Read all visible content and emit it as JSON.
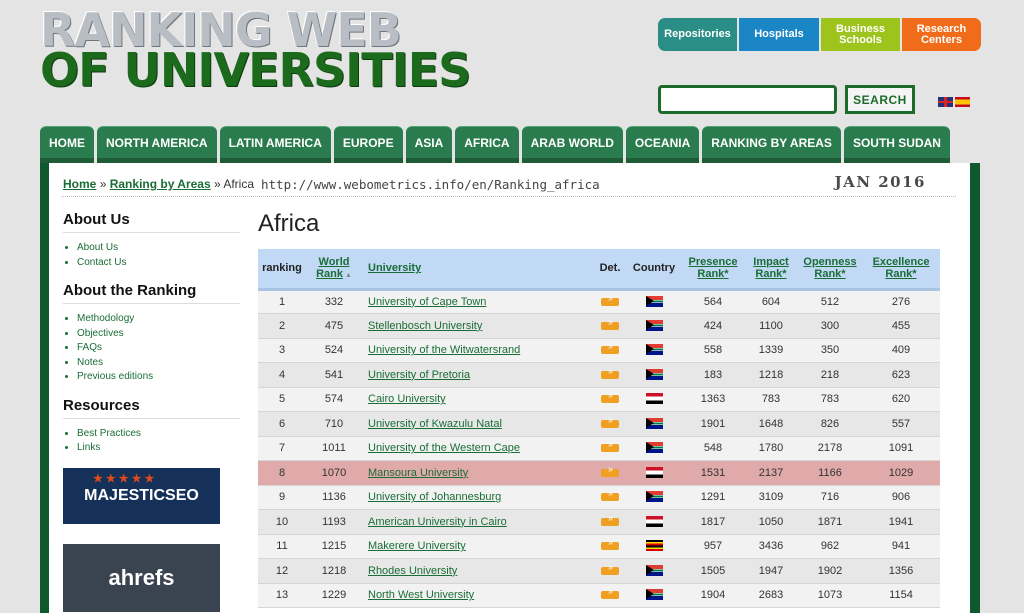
{
  "logo": {
    "line1": "RANKING WEB",
    "line2": "OF UNIVERSITIES"
  },
  "top_buttons": [
    "Repositories",
    "Hospitals",
    "Business\nSchools",
    "Research\nCenters"
  ],
  "search": {
    "placeholder": "",
    "button": "SEARCH"
  },
  "nav": [
    "HOME",
    "NORTH AMERICA",
    "LATIN AMERICA",
    "EUROPE",
    "ASIA",
    "AFRICA",
    "ARAB WORLD",
    "OCEANIA",
    "RANKING BY AREAS",
    "SOUTH SUDAN"
  ],
  "breadcrumb": {
    "home": "Home",
    "sep": "»",
    "ranking": "Ranking by Areas",
    "current": "Africa"
  },
  "url": "http://www.webometrics.info/en/Ranking_africa",
  "edition": "JAN 2016",
  "sidebar": {
    "about_us": {
      "heading": "About Us",
      "items": [
        "About Us",
        "Contact Us"
      ]
    },
    "about_ranking": {
      "heading": "About the Ranking",
      "items": [
        "Methodology",
        "Objectives",
        "FAQs",
        "Notes",
        "Previous editions"
      ]
    },
    "resources": {
      "heading": "Resources",
      "items": [
        "Best Practices",
        "Links"
      ]
    },
    "banners": [
      "MAJESTICSEO",
      "ahrefs"
    ]
  },
  "page_title": "Africa",
  "table": {
    "headers": {
      "ranking": "ranking",
      "world": "World",
      "world2": "Rank",
      "university": "University",
      "det": "Det.",
      "country": "Country",
      "presence": "Presence",
      "presence2": "Rank*",
      "impact": "Impact",
      "impact2": "Rank*",
      "openness": "Openness",
      "openness2": "Rank*",
      "excellence": "Excellence",
      "excellence2": "Rank*"
    },
    "rows": [
      {
        "rank": "1",
        "world": "332",
        "name": "University of Cape Town",
        "flag": "za",
        "presence": "564",
        "impact": "604",
        "openness": "512",
        "excellence": "276"
      },
      {
        "rank": "2",
        "world": "475",
        "name": "Stellenbosch University",
        "flag": "za",
        "presence": "424",
        "impact": "1100",
        "openness": "300",
        "excellence": "455"
      },
      {
        "rank": "3",
        "world": "524",
        "name": "University of the Witwatersrand",
        "flag": "za",
        "presence": "558",
        "impact": "1339",
        "openness": "350",
        "excellence": "409"
      },
      {
        "rank": "4",
        "world": "541",
        "name": "University of Pretoria",
        "flag": "za",
        "presence": "183",
        "impact": "1218",
        "openness": "218",
        "excellence": "623"
      },
      {
        "rank": "5",
        "world": "574",
        "name": "Cairo University",
        "flag": "eg",
        "presence": "1363",
        "impact": "783",
        "openness": "783",
        "excellence": "620"
      },
      {
        "rank": "6",
        "world": "710",
        "name": "University of Kwazulu Natal",
        "flag": "za",
        "presence": "1901",
        "impact": "1648",
        "openness": "826",
        "excellence": "557"
      },
      {
        "rank": "7",
        "world": "1011",
        "name": "University of the Western Cape",
        "flag": "za",
        "presence": "548",
        "impact": "1780",
        "openness": "2178",
        "excellence": "1091"
      },
      {
        "rank": "8",
        "world": "1070",
        "name": "Mansoura University",
        "flag": "eg",
        "presence": "1531",
        "impact": "2137",
        "openness": "1166",
        "excellence": "1029",
        "highlight": true
      },
      {
        "rank": "9",
        "world": "1136",
        "name": "University of Johannesburg",
        "flag": "za",
        "presence": "1291",
        "impact": "3109",
        "openness": "716",
        "excellence": "906"
      },
      {
        "rank": "10",
        "world": "1193",
        "name": "American University in Cairo",
        "flag": "eg",
        "presence": "1817",
        "impact": "1050",
        "openness": "1871",
        "excellence": "1941"
      },
      {
        "rank": "11",
        "world": "1215",
        "name": "Makerere University",
        "flag": "ug",
        "presence": "957",
        "impact": "3436",
        "openness": "962",
        "excellence": "941"
      },
      {
        "rank": "12",
        "world": "1218",
        "name": "Rhodes University",
        "flag": "za",
        "presence": "1505",
        "impact": "1947",
        "openness": "1902",
        "excellence": "1356"
      },
      {
        "rank": "13",
        "world": "1229",
        "name": "North West University",
        "flag": "za",
        "presence": "1904",
        "impact": "2683",
        "openness": "1073",
        "excellence": "1154"
      }
    ]
  }
}
